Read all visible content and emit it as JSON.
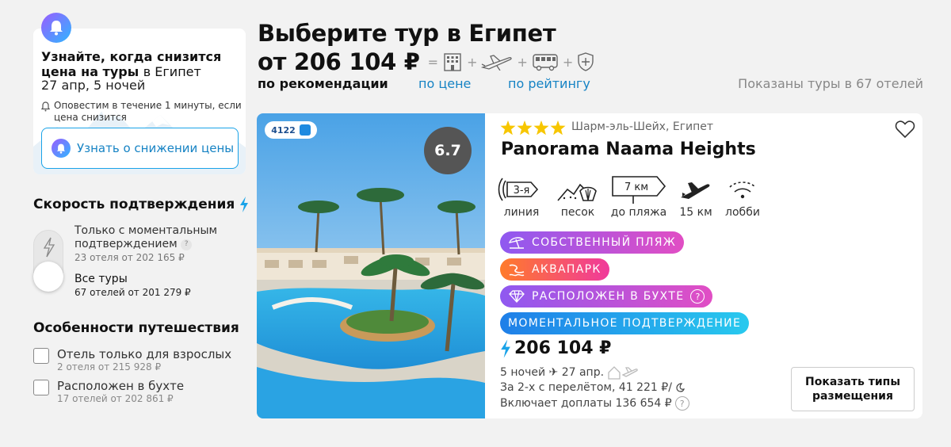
{
  "subscription": {
    "title_bold": "Узнайте, когда снизится цена на туры",
    "title_dest": "в Египет",
    "dates": "27 апр,  5 ночей",
    "note": "Оповестим в течение 1 минуты, если цена снизится",
    "button_label": "Узнать о снижении цены"
  },
  "filters": {
    "speed": {
      "heading": "Скорость подтверждения",
      "options": [
        {
          "label": "Только с моментальным подтверждением",
          "sub": "23 отеля от 202 165 ₽"
        },
        {
          "label": "Все туры",
          "sub": "67 отелей от 201 279 ₽"
        }
      ]
    },
    "features": {
      "heading": "Особенности путешествия",
      "items": [
        {
          "label": "Отель только для взрослых",
          "sub": "2 отеля от 215 928 ₽"
        },
        {
          "label": "Расположен в бухте",
          "sub": "17 отелей от 202 861 ₽"
        }
      ]
    }
  },
  "header": {
    "title": "Выберите тур в Египет",
    "price": "от 206 104 ₽",
    "composition_equals": "=",
    "composition_plus": "+",
    "composition_icons": [
      "hotel-icon",
      "plane-icon",
      "bus-icon",
      "shield-plus-icon"
    ]
  },
  "sort": {
    "active": "по рекомендации",
    "by_price": "по цене",
    "by_rating": "по рейтингу",
    "count": "Показаны туры в 67 отелей"
  },
  "hotel": {
    "operator_code": "4122",
    "rating": "6.7",
    "stars": 4,
    "location": "Шарм-эль-Шейх, Египет",
    "name": "Panorama Naama Heights",
    "features": [
      {
        "icon": "line-waves-icon",
        "badge": "3-я",
        "caption": "линия"
      },
      {
        "icon": "sand-shell-icon",
        "caption": "песок"
      },
      {
        "icon": "sign-arrow-icon",
        "badge": "7 км",
        "caption": "до пляжа"
      },
      {
        "icon": "airplane-icon",
        "caption": "15 км"
      },
      {
        "icon": "wifi-icon",
        "caption": "лобби"
      }
    ],
    "tags": [
      {
        "label": "СОБСТВЕННЫЙ ПЛЯЖ",
        "icon": "umbrella-icon",
        "color_from": "#8f59f0",
        "color_to": "#e14ec4"
      },
      {
        "label": "АКВАПАРК",
        "icon": "waterslide-icon",
        "color_from": "#ff7b2a",
        "color_to": "#f0399c"
      },
      {
        "label": "РАСПОЛОЖЕН В БУХТЕ",
        "icon": "diamond-icon",
        "color_from": "#8f59f0",
        "color_to": "#e14ec4",
        "help": "?"
      },
      {
        "label": "МОМЕНТАЛЬНОЕ ПОДТВЕРЖДЕНИЕ",
        "color_from": "#1f7fe8",
        "color_to": "#28c9ee"
      }
    ],
    "price": "206 104 ₽",
    "nights_dates": "5 ночей ✈ 27 апр.",
    "per_person": "За 2-х с перелётом, 41 221 ₽/",
    "extras": "Включает доплаты 136 654 ₽",
    "extras_help": "?",
    "types_button": "Показать типы размещения"
  }
}
